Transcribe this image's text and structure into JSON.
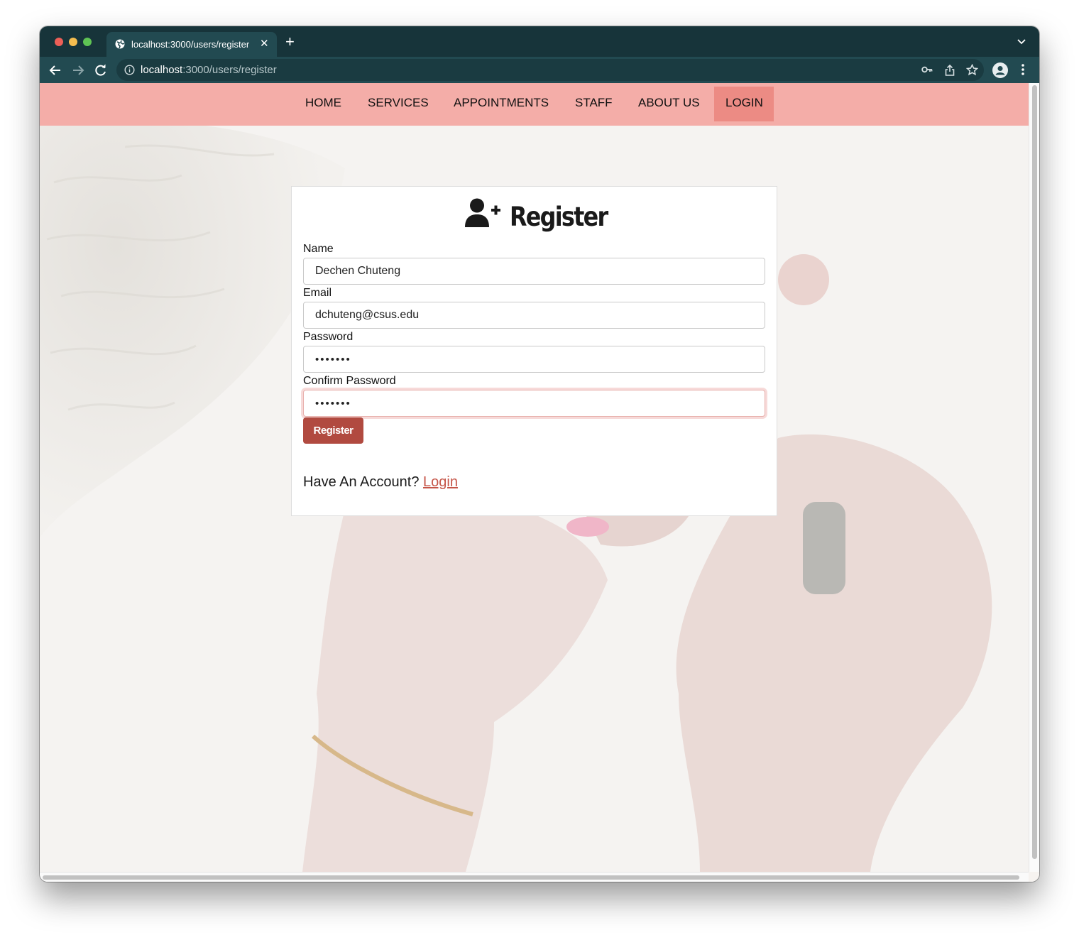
{
  "browser": {
    "tab_title": "localhost:3000/users/register",
    "url_host": "localhost",
    "url_rest": ":3000/users/register"
  },
  "site_nav": {
    "items": [
      {
        "label": "HOME",
        "active": false
      },
      {
        "label": "SERVICES",
        "active": false
      },
      {
        "label": "APPOINTMENTS",
        "active": false
      },
      {
        "label": "STAFF",
        "active": false
      },
      {
        "label": "ABOUT US",
        "active": false
      },
      {
        "label": "LOGIN",
        "active": true
      }
    ]
  },
  "register": {
    "title": "Register",
    "icon": "user-plus-icon",
    "fields": {
      "name": {
        "label": "Name",
        "value": "Dechen Chuteng"
      },
      "email": {
        "label": "Email",
        "value": "dchuteng@csus.edu"
      },
      "password": {
        "label": "Password",
        "value": "•••••••"
      },
      "confirm_password": {
        "label": "Confirm Password",
        "value": "•••••••"
      }
    },
    "submit_label": "Register",
    "account_prompt": "Have An Account?",
    "login_link": "Login"
  },
  "colors": {
    "nav_bg": "#f4ada8",
    "nav_active": "#ec8b84",
    "button": "#b14a40",
    "link": "#c55548",
    "browser_chrome": "#224a51"
  }
}
